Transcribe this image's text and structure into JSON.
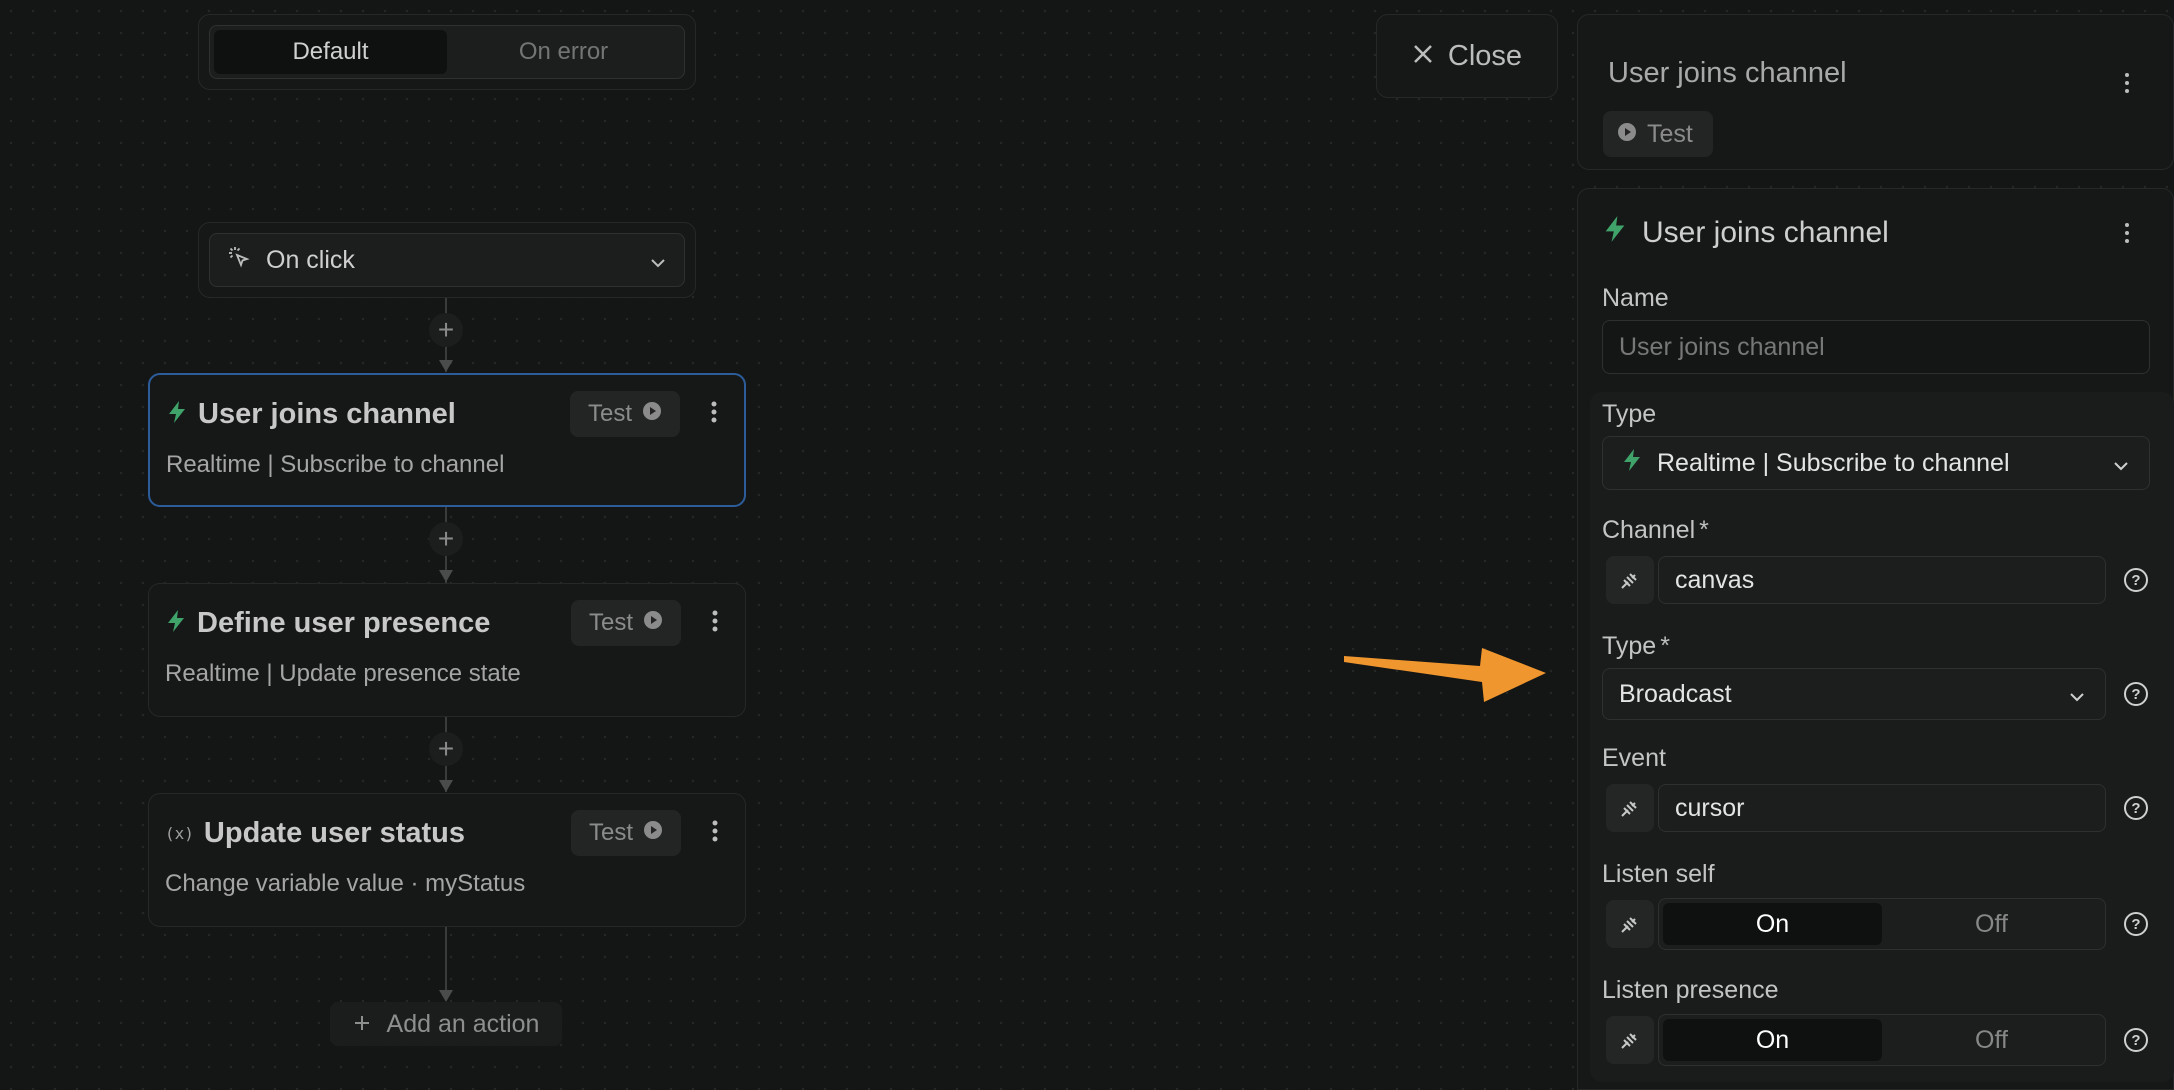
{
  "tabs": {
    "default": "Default",
    "on_error": "On error"
  },
  "trigger": {
    "label": "On click"
  },
  "actions": [
    {
      "title": "User joins channel",
      "subtitle": "Realtime | Subscribe to channel",
      "test": "Test",
      "icon": "bolt-icon"
    },
    {
      "title": "Define user presence",
      "subtitle": "Realtime | Update presence state",
      "test": "Test",
      "icon": "bolt-icon"
    },
    {
      "title": "Update user status",
      "subtitle": "Change variable value · myStatus",
      "test": "Test",
      "icon": "variable-icon"
    }
  ],
  "add_action": "Add an action",
  "close": "Close",
  "panel_header": {
    "title": "User joins channel",
    "test": "Test"
  },
  "form": {
    "title": "User joins channel",
    "name_label": "Name",
    "name_placeholder": "User joins channel",
    "type_label": "Type",
    "type_value": "Realtime | Subscribe to channel",
    "channel_label": "Channel",
    "channel_value": "canvas",
    "broadcast_type_label": "Type",
    "broadcast_type_value": "Broadcast",
    "event_label": "Event",
    "event_value": "cursor",
    "listen_self_label": "Listen self",
    "listen_presence_label": "Listen presence",
    "on": "On",
    "off": "Off",
    "required_mark": "*"
  },
  "colors": {
    "accent_green": "#3fa36a",
    "selected_border": "#2c5d9a",
    "arrow": "#f0962e"
  }
}
